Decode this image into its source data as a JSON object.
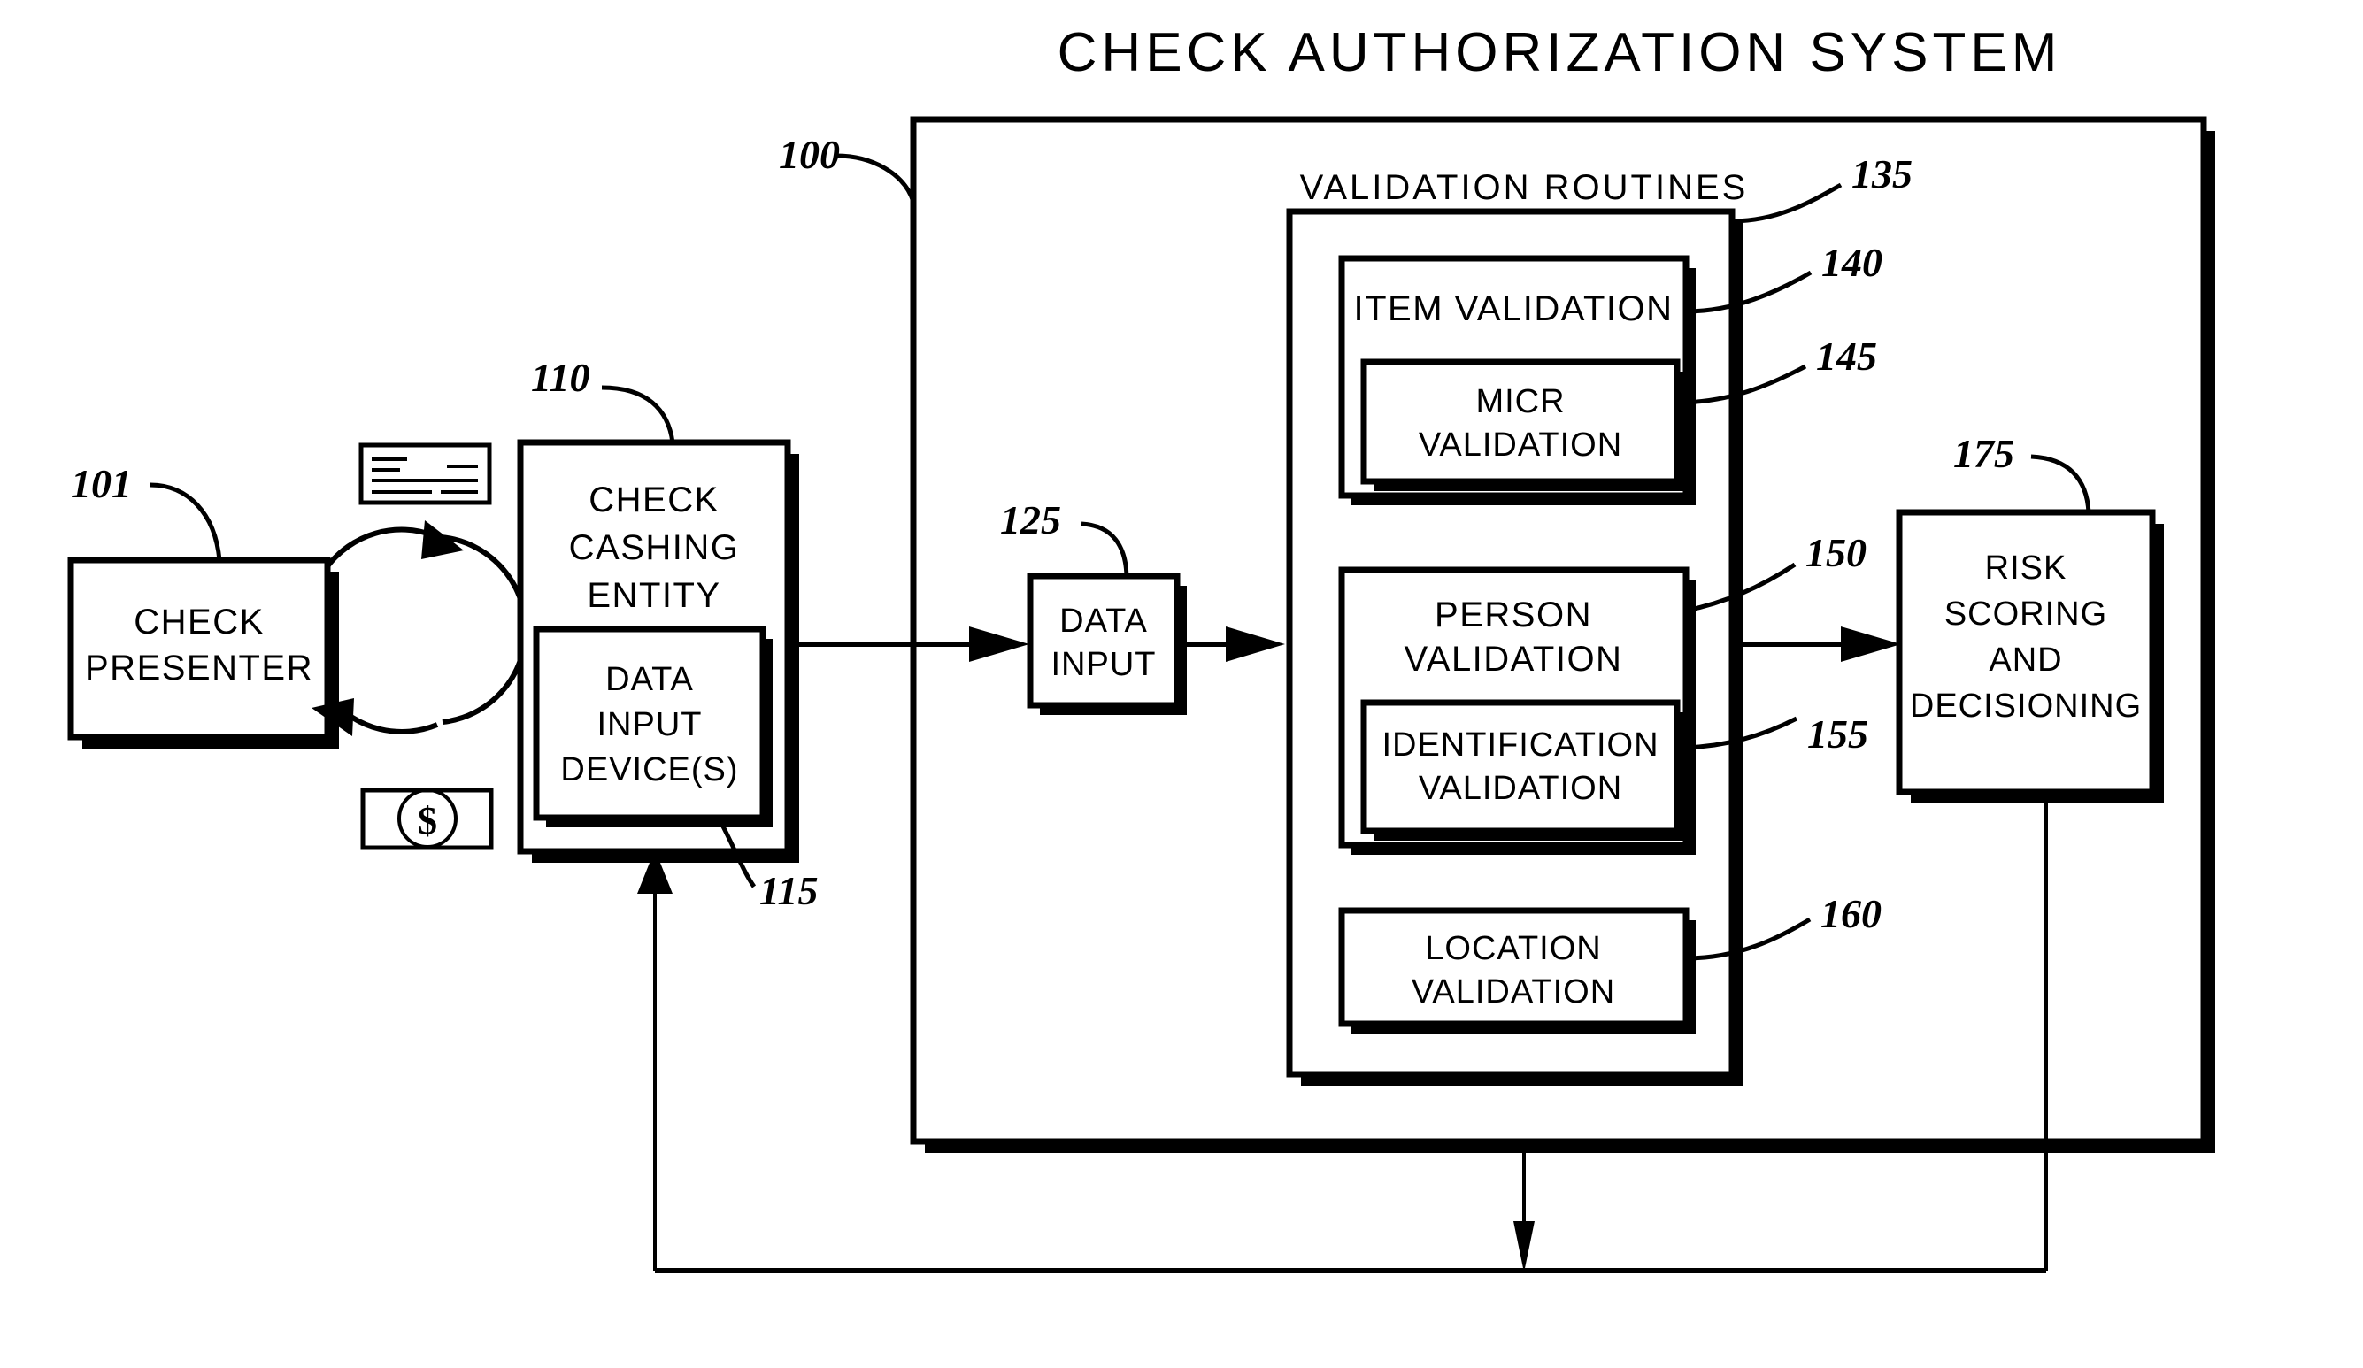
{
  "figure": {
    "title": "CHECK  AUTHORIZATION  SYSTEM",
    "system_ref": "100"
  },
  "nodes": {
    "check_presenter": {
      "label_line1": "CHECK",
      "label_line2": "PRESENTER",
      "ref": "101"
    },
    "check_cashing_entity": {
      "label_line1": "CHECK",
      "label_line2": "CASHING",
      "label_line3": "ENTITY",
      "ref": "110"
    },
    "data_input_devices": {
      "label_line1": "DATA",
      "label_line2": "INPUT",
      "label_line3": "DEVICE(S)",
      "ref": "115"
    },
    "data_input": {
      "label_line1": "DATA",
      "label_line2": "INPUT",
      "ref": "125"
    },
    "validation_routines": {
      "label": "VALIDATION  ROUTINES",
      "ref": "135"
    },
    "item_validation": {
      "label": "ITEM  VALIDATION",
      "ref": "140"
    },
    "micr_validation": {
      "label_line1": "MICR",
      "label_line2": "VALIDATION",
      "ref": "145"
    },
    "person_validation": {
      "label_line1": "PERSON",
      "label_line2": "VALIDATION",
      "ref": "150"
    },
    "identification_validation": {
      "label_line1": "IDENTIFICATION",
      "label_line2": "VALIDATION",
      "ref": "155"
    },
    "location_validation": {
      "label_line1": "LOCATION",
      "label_line2": "VALIDATION",
      "ref": "160"
    },
    "risk_scoring": {
      "label_line1": "RISK",
      "label_line2": "SCORING",
      "label_line3": "AND",
      "label_line4": "DECISIONING",
      "ref": "175"
    }
  },
  "icons": {
    "check_document": "check-document-icon",
    "cash_bill": "dollar-bill-icon",
    "exchange_cycle": "circular-exchange-arrows-icon"
  },
  "colors": {
    "ink": "#000000",
    "paper": "#ffffff"
  }
}
